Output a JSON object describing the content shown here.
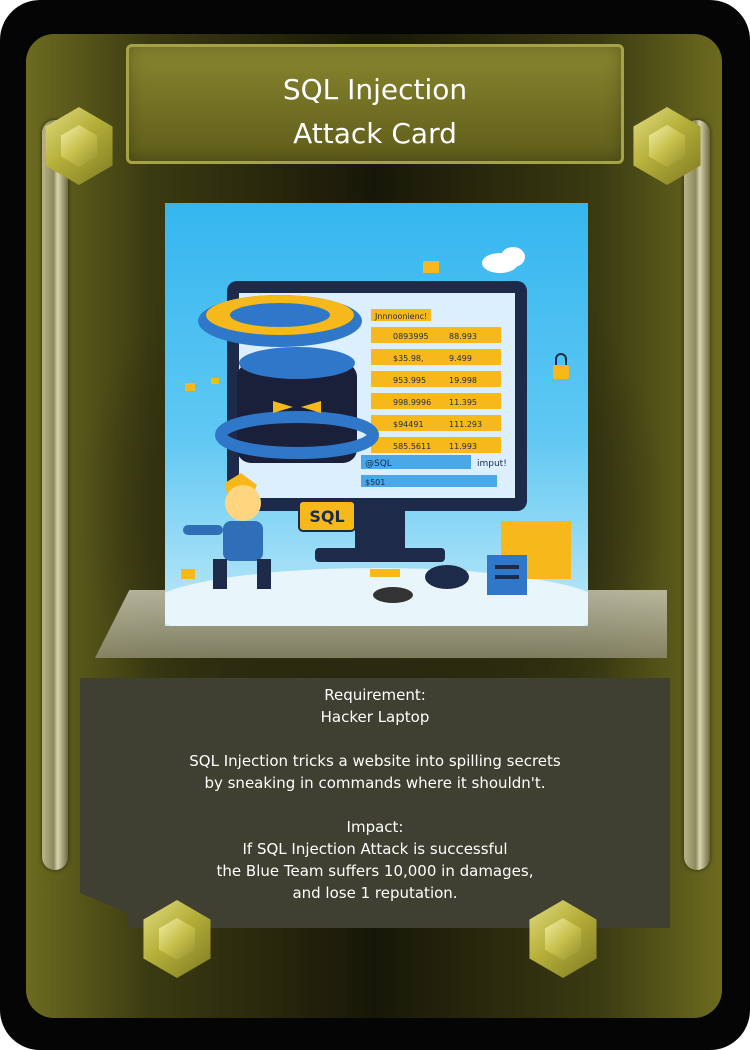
{
  "card": {
    "title_line1": "SQL Injection",
    "title_line2": "Attack Card",
    "art": {
      "label_sql": "SQL",
      "screen_header": "Jnnnoonienc!",
      "screen_rows": [
        [
          "0893995",
          "88.993"
        ],
        [
          "$35.98,",
          "9.499"
        ],
        [
          "953.995",
          "19.998"
        ],
        [
          "998.9996",
          "11.395"
        ],
        [
          "$94491",
          "111.293"
        ],
        [
          "585.5611",
          "11.993"
        ]
      ],
      "input_label": "@SQL",
      "input_suffix": "imput!",
      "input2_label": "$501"
    },
    "requirement_label": "Requirement:",
    "requirement_value": "Hacker Laptop",
    "description_line1": "SQL Injection tricks a website into spilling secrets",
    "description_line2": "by sneaking in commands where it shouldn't.",
    "impact_label": "Impact:",
    "impact_line1": "If SQL Injection Attack is successful",
    "impact_line2": "the Blue Team suffers 10,000 in damages,",
    "impact_line3": "and lose 1 reputation."
  },
  "colors": {
    "frame_olive": "#6d6b1f",
    "title_plate": "#7a7828",
    "art_sky": "#35b6ef",
    "text_panel": "#3f3f32",
    "text": "#ffffff"
  }
}
